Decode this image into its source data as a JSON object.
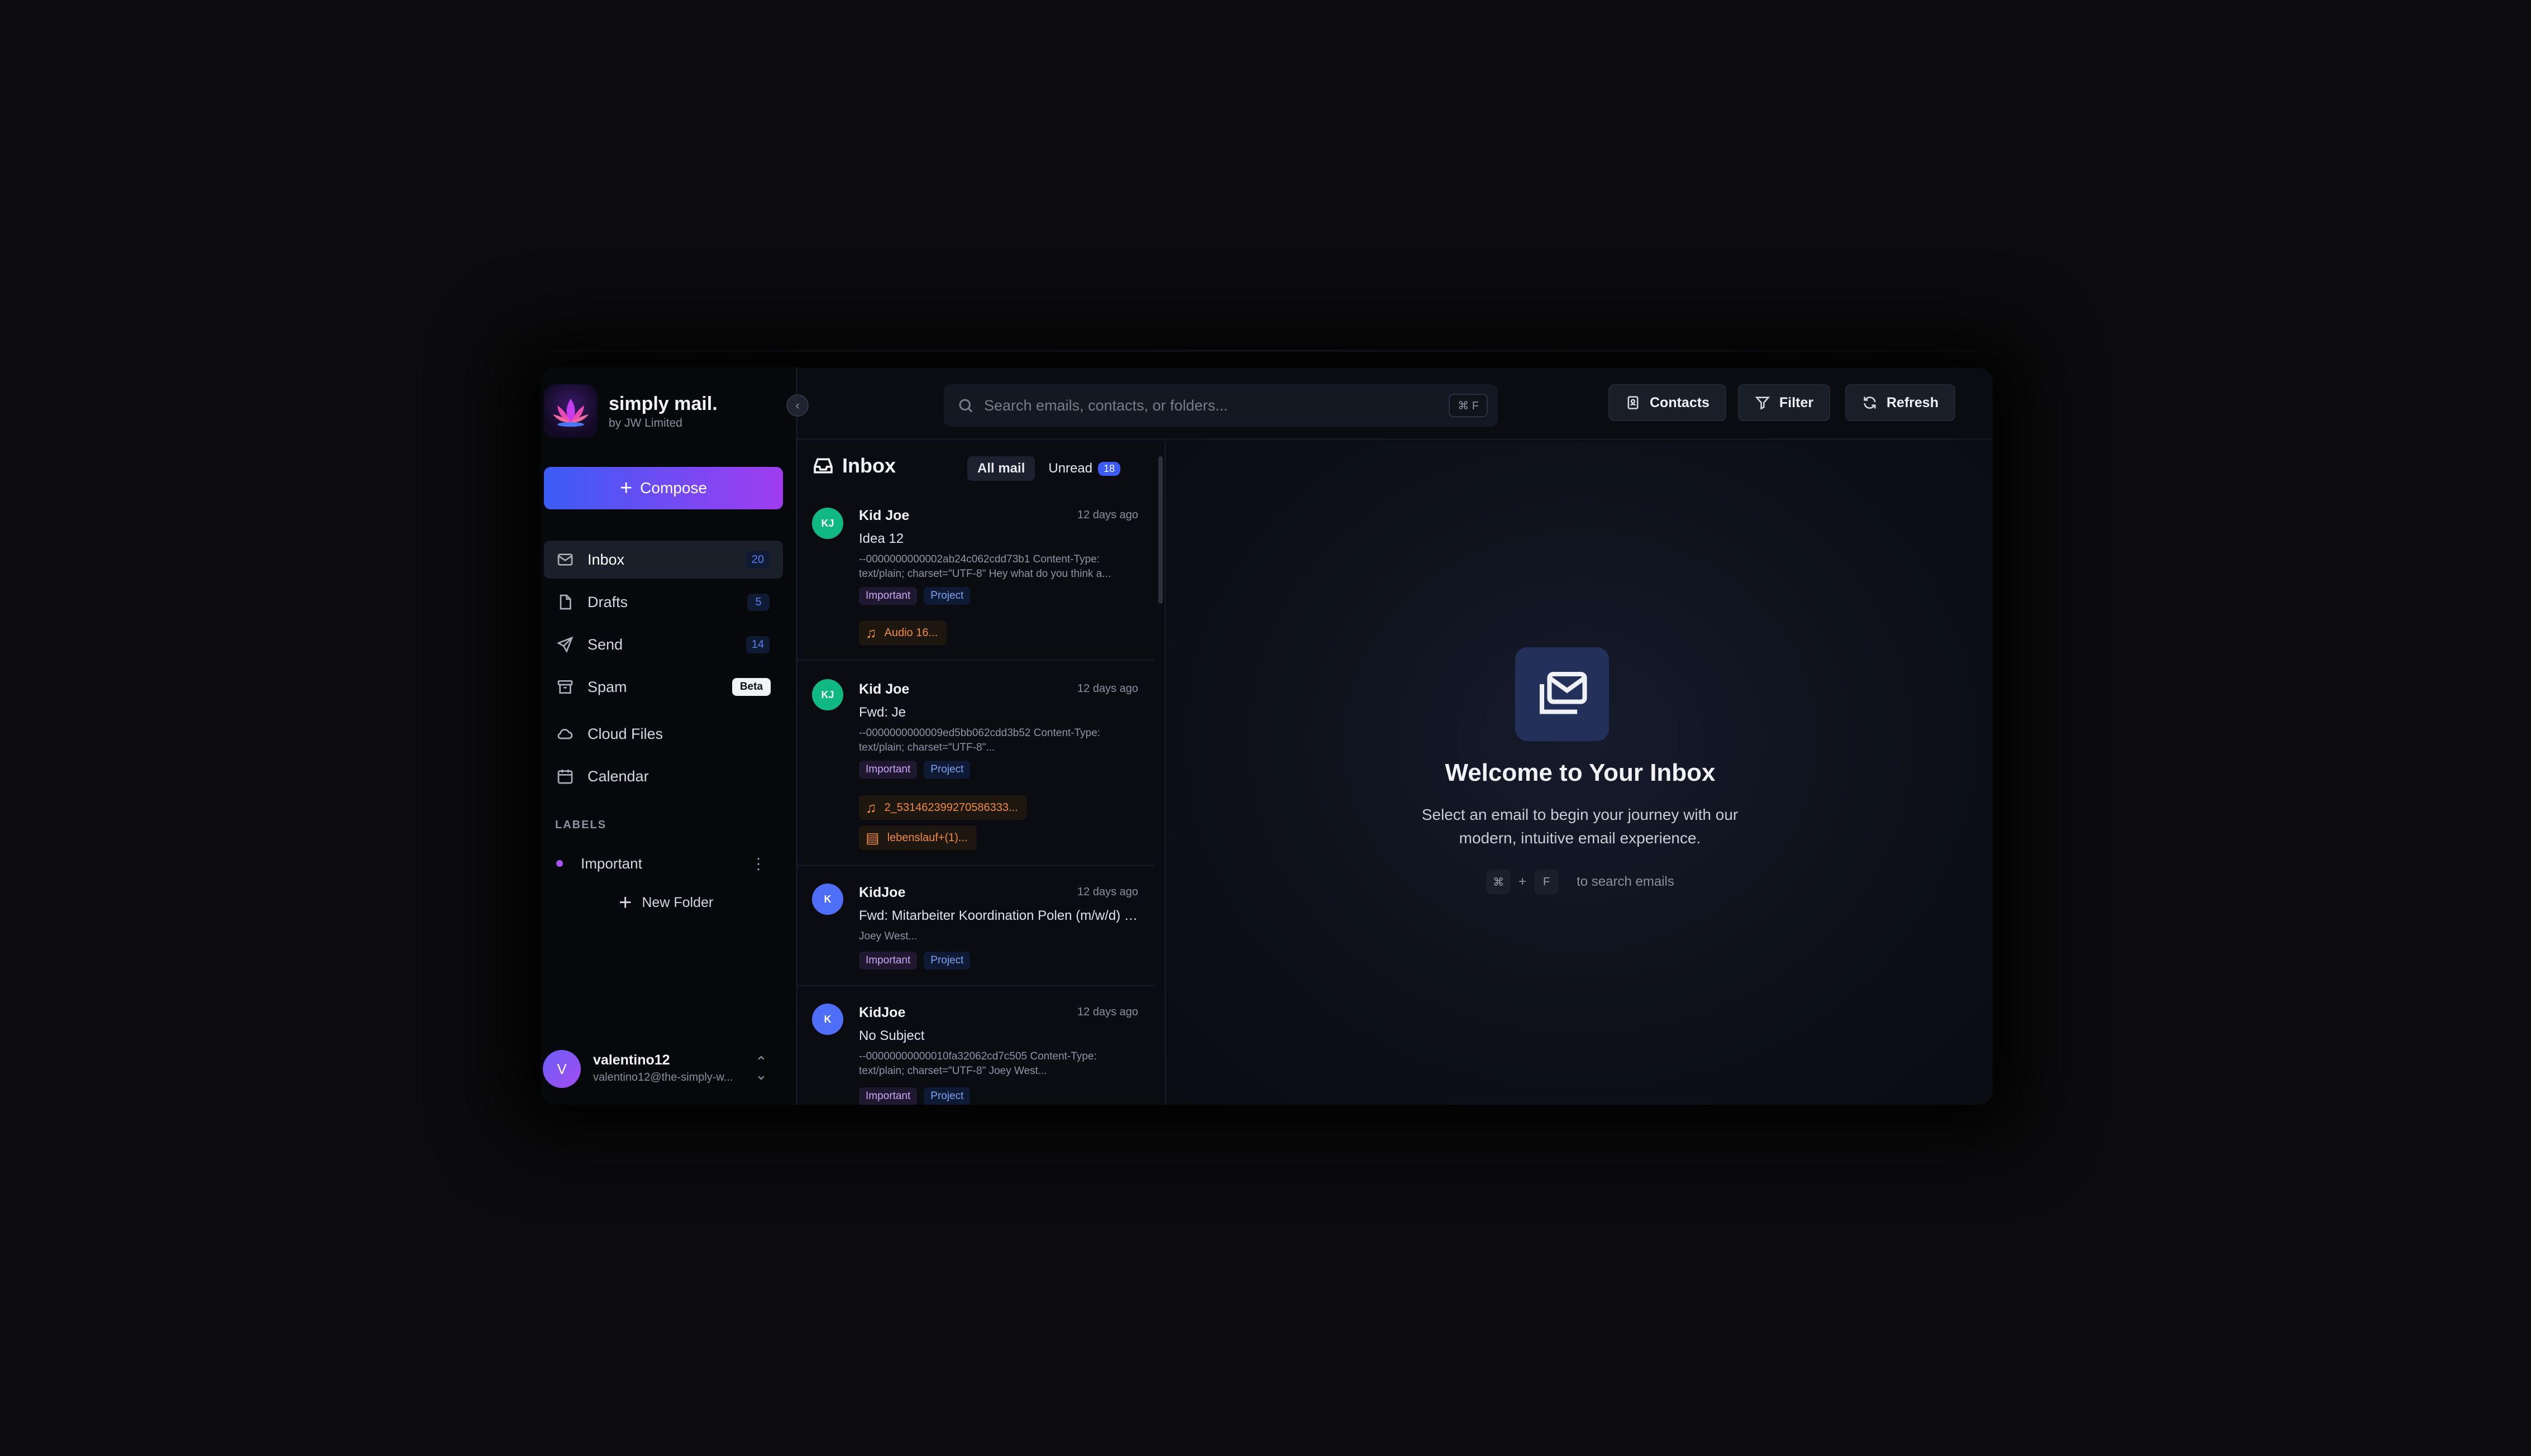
{
  "brand": {
    "name": "simply mail.",
    "sub": "by JW Limited"
  },
  "compose_label": "Compose",
  "nav": [
    {
      "label": "Inbox",
      "count": "20"
    },
    {
      "label": "Drafts",
      "count": "5"
    },
    {
      "label": "Send",
      "count": "14"
    },
    {
      "label": "Spam",
      "badge": "Beta"
    },
    {
      "label": "Cloud Files"
    },
    {
      "label": "Calendar"
    }
  ],
  "labels": {
    "title": "LABELS",
    "items": [
      {
        "label": "Important",
        "color": "#a855f7"
      }
    ],
    "new_folder": "New Folder"
  },
  "user": {
    "initial": "V",
    "name": "valentino12",
    "email": "valentino12@the-simply-w..."
  },
  "search": {
    "placeholder": "Search emails, contacts, or folders...",
    "shortcut": "⌘ F"
  },
  "toolbar": {
    "contacts": "Contacts",
    "filter": "Filter",
    "refresh": "Refresh"
  },
  "list": {
    "title": "Inbox",
    "tabs": {
      "all": "All mail",
      "unread": "Unread",
      "unread_count": "18"
    },
    "emails": [
      {
        "initials": "KJ",
        "avatar_color": "#10b981",
        "from": "Kid Joe",
        "date": "12 days ago",
        "subject": "Idea 12",
        "preview": "--0000000000002ab24c062cdd73b1 Content-Type: text/plain; charset=\"UTF-8\" Hey what do you think a...",
        "tags": [
          "Important",
          "Project"
        ],
        "attachments": [
          {
            "icon": "music-icon",
            "name": "Audio 16..."
          }
        ]
      },
      {
        "initials": "KJ",
        "avatar_color": "#10b981",
        "from": "Kid Joe",
        "date": "12 days ago",
        "subject": "Fwd: Je",
        "preview": "--0000000000009ed5bb062cdd3b52 Content-Type: text/plain; charset=\"UTF-8\"...",
        "tags": [
          "Important",
          "Project"
        ],
        "attachments": [
          {
            "icon": "music-icon",
            "name": "2_531462399270586333..."
          },
          {
            "icon": "file-icon",
            "name": "lebenslauf+(1)..."
          }
        ]
      },
      {
        "initials": "K",
        "avatar_color": "#4f6ef7",
        "from": "KidJoe",
        "date": "12 days ago",
        "subject": "Fwd: Mitarbeiter Koordination Polen (m/w/d) bei...",
        "preview": "Joey West...",
        "tags": [
          "Important",
          "Project"
        ],
        "attachments": []
      },
      {
        "initials": "K",
        "avatar_color": "#4f6ef7",
        "from": "KidJoe",
        "date": "12 days ago",
        "subject": "No Subject",
        "preview": "--00000000000010fa32062cd7c505 Content-Type: text/plain; charset=\"UTF-8\" Joey West...",
        "tags": [
          "Important",
          "Project"
        ],
        "attachments": []
      }
    ]
  },
  "welcome": {
    "title": "Welcome to Your Inbox",
    "desc": "Select an email to begin your journey with our modern, intuitive email experience.",
    "key1": "⌘",
    "plus": "+",
    "key2": "F",
    "hint": "to search emails"
  }
}
